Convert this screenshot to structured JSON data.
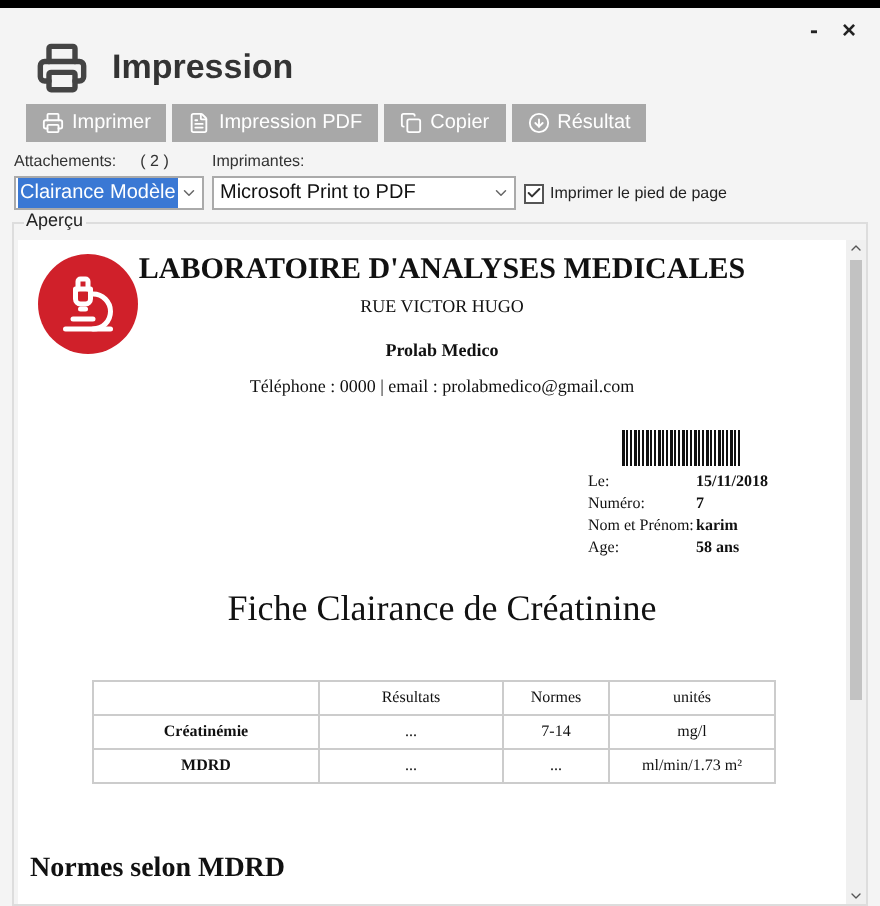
{
  "window": {
    "title": "Impression",
    "controls": [
      "-",
      "×"
    ]
  },
  "toolbar": [
    {
      "label": "Imprimer",
      "kind": "print"
    },
    {
      "label": "Impression PDF",
      "kind": "pdf"
    },
    {
      "label": "Copier",
      "kind": "copy"
    },
    {
      "label": "Résultat",
      "kind": "download"
    }
  ],
  "attachments": {
    "label": "Attachements:",
    "count": "( 2 )",
    "value": "Clairance Modèle"
  },
  "printers": {
    "label": "Imprimantes:",
    "value": "Microsoft Print to PDF"
  },
  "footer_option": {
    "label": "Imprimer le pied de page",
    "checked": true
  },
  "preview": {
    "title": "Aperçu",
    "header": {
      "lab": "LABORATOIRE D'ANALYSES MEDICALES",
      "street": "RUE VICTOR HUGO",
      "name": "Prolab Medico",
      "contact": "Téléphone : 0000 | email : prolabmedico@gmail.com"
    },
    "patient": [
      {
        "label": "Le:",
        "value": "15/11/2018"
      },
      {
        "label": "Numéro:",
        "value": "7"
      },
      {
        "label": "Nom et Prénom:",
        "value": "karim"
      },
      {
        "label": "Age:",
        "value": "58 ans"
      }
    ],
    "heading": "Fiche Clairance de Créatinine",
    "table": {
      "columns": [
        "",
        "Résultats",
        "Normes",
        "unités"
      ],
      "rows": [
        [
          "Créatinémie",
          "...",
          "7-14",
          "mg/l"
        ],
        [
          "MDRD",
          "...",
          "...",
          "ml/min/1.73 m²"
        ]
      ]
    },
    "section": "Normes selon MDRD"
  }
}
